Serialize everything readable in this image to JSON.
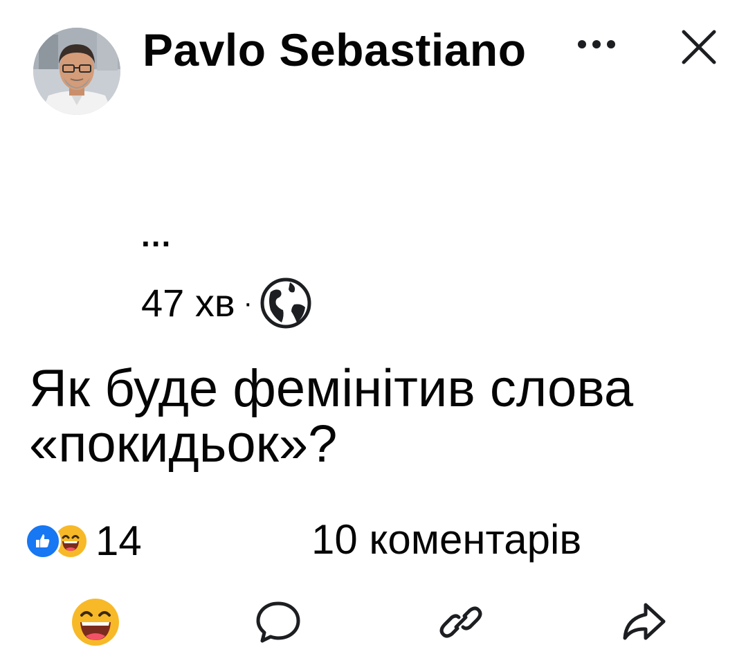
{
  "post": {
    "author": {
      "name": "Pavlo Sebastiano",
      "name_overflow": "..."
    },
    "timestamp": "47 хв",
    "separator": "·",
    "privacy_icon": "globe-icon",
    "text": "Як буде фемінітив слова «покидьок»?",
    "reactions": {
      "types": [
        "like-reaction-icon",
        "haha-reaction-icon"
      ],
      "count": "14"
    },
    "comments_label": "10 коментарів"
  },
  "header_icons": [
    "more-options-icon",
    "close-icon"
  ],
  "action_bar": [
    "haha-react-icon",
    "comment-icon",
    "link-icon",
    "share-icon"
  ],
  "colors": {
    "text": "#050505",
    "like_blue": "#1877f2",
    "emoji_yellow": "#f7b928",
    "emoji_mouth": "#7a2b1d",
    "icon_gray": "#65676b"
  }
}
